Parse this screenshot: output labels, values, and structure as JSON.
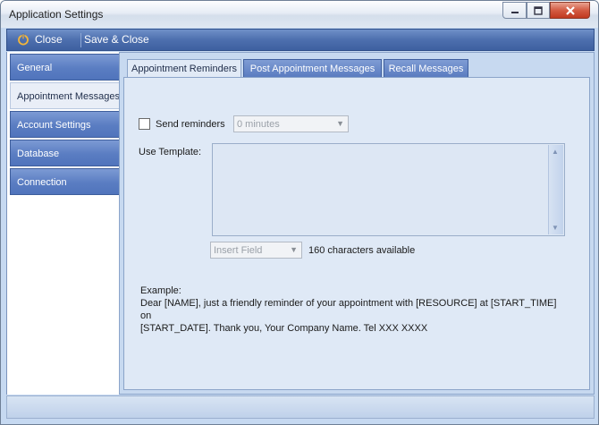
{
  "window": {
    "title": "Application Settings"
  },
  "window_controls": [
    "minimize-icon",
    "maximize-icon",
    "close-icon"
  ],
  "toolbar": {
    "close_label": "Close",
    "save_close_label": "Save & Close"
  },
  "sidebar": {
    "items": [
      {
        "label": "General",
        "active": false
      },
      {
        "label": "Appointment Messages",
        "active": true
      },
      {
        "label": "Account Settings",
        "active": false
      },
      {
        "label": "Database",
        "active": false
      },
      {
        "label": "Connection",
        "active": false
      }
    ]
  },
  "tabs": [
    {
      "label": "Appointment Reminders",
      "active": true
    },
    {
      "label": "Post Appointment Messages",
      "active": false
    },
    {
      "label": "Recall Messages",
      "active": false
    }
  ],
  "reminders": {
    "send_label": "Send reminders",
    "send_checked": false,
    "interval_value": "0 minutes",
    "template_label": "Use Template:",
    "template_value": "",
    "insert_field_value": "Insert Field",
    "chars_available": "160 characters available",
    "example_heading": "Example:",
    "example_line1": "Dear [NAME], just a friendly reminder of your appointment with [RESOURCE] at [START_TIME] on",
    "example_line2": "[START_DATE].  Thank you,  Your Company Name. Tel XXX XXXX"
  },
  "colors": {
    "toolbar_blue": "#4d6fae",
    "content_bg": "#c7d9f0",
    "close_red": "#c0391f"
  }
}
